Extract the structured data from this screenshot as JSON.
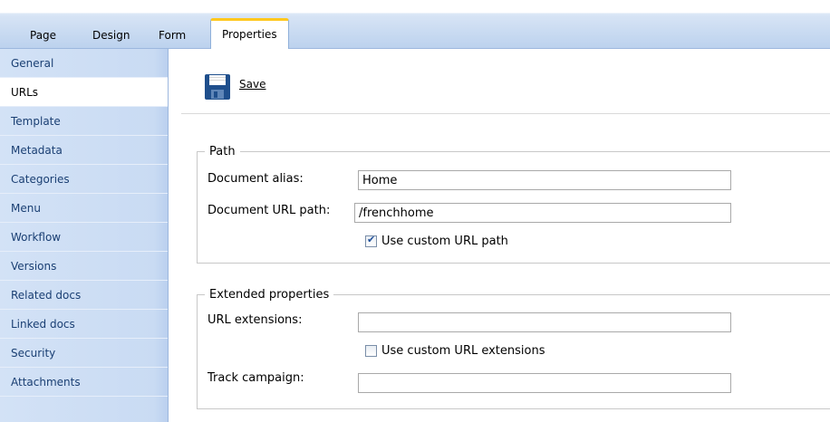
{
  "tabs": [
    {
      "label": "Page",
      "active": false
    },
    {
      "label": "Design",
      "active": false
    },
    {
      "label": "Form",
      "active": false
    },
    {
      "label": "Properties",
      "active": true
    }
  ],
  "sidebar": {
    "items": [
      {
        "label": "General"
      },
      {
        "label": "URLs",
        "active": true
      },
      {
        "label": "Template"
      },
      {
        "label": "Metadata"
      },
      {
        "label": "Categories"
      },
      {
        "label": "Menu"
      },
      {
        "label": "Workflow"
      },
      {
        "label": "Versions"
      },
      {
        "label": "Related docs"
      },
      {
        "label": "Linked docs"
      },
      {
        "label": "Security"
      },
      {
        "label": "Attachments"
      }
    ]
  },
  "toolbar": {
    "save_label": "Save",
    "save_icon": "floppy-disk-icon"
  },
  "path": {
    "legend": "Path",
    "alias_label": "Document alias:",
    "alias_value": "Home",
    "url_path_label": "Document URL path:",
    "url_path_value": "/frenchhome",
    "custom_url_label": "Use custom URL path",
    "custom_url_checked": true
  },
  "extended": {
    "legend": "Extended properties",
    "url_ext_label": "URL extensions:",
    "url_ext_value": "",
    "custom_ext_label": "Use custom URL extensions",
    "custom_ext_checked": false,
    "campaign_label": "Track campaign:",
    "campaign_value": ""
  },
  "colors": {
    "active_tab_accent": "#ffc81e",
    "sidebar_bg": "#c9dbf3",
    "link_color": "#1a3f73"
  }
}
